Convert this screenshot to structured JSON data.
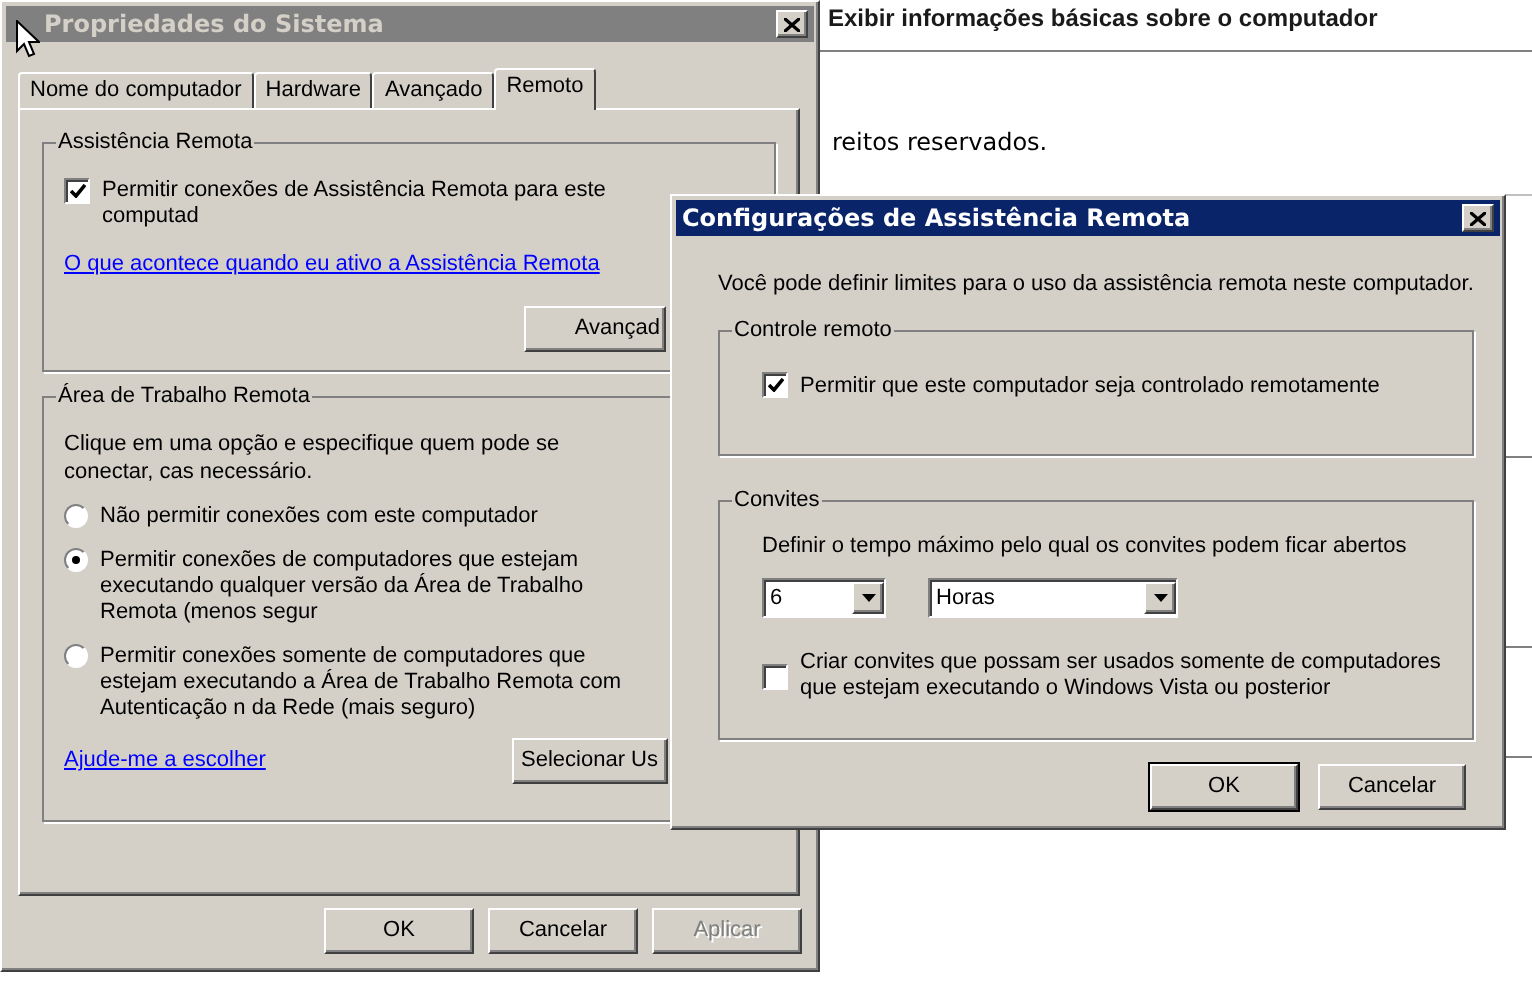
{
  "background": {
    "heading": "Exibir informações básicas sobre o computador",
    "text": "reitos reservados."
  },
  "system_properties": {
    "title": "Propriedades do Sistema",
    "active": false,
    "tabs": [
      {
        "label": "Nome do computador",
        "selected": false
      },
      {
        "label": "Hardware",
        "selected": false
      },
      {
        "label": "Avançado",
        "selected": false
      },
      {
        "label": "Remoto",
        "selected": true
      }
    ],
    "remote_assistance": {
      "title": "Assistência Remota",
      "checkbox": {
        "label": "Permitir conexões de Assistência Remota para este computad",
        "checked": true
      },
      "link": "O que acontece quando eu ativo a Assistência Remota",
      "button": "Avançad"
    },
    "remote_desktop": {
      "title": "Área de Trabalho Remota",
      "description": "Clique em uma opção e especifique quem pode se conectar, cas necessário.",
      "options": [
        {
          "label": "Não permitir conexões com este computador",
          "selected": false
        },
        {
          "label": "Permitir conexões de computadores que estejam executando qualquer versão da Área de Trabalho Remota (menos segur",
          "selected": true
        },
        {
          "label": "Permitir conexões somente de computadores que estejam executando a Área de Trabalho Remota com Autenticação n da Rede (mais seguro)",
          "selected": false
        }
      ],
      "link": "Ajude-me a escolher",
      "button": "Selecionar Us"
    },
    "buttons": [
      {
        "label": "OK",
        "disabled": false
      },
      {
        "label": "Cancelar",
        "disabled": false
      },
      {
        "label": "Aplicar",
        "disabled": true
      }
    ]
  },
  "remote_assistance_settings": {
    "title": "Configurações de Assistência Remota",
    "active": true,
    "intro": "Você pode definir limites para o uso da assistência remota neste computador.",
    "remote_control": {
      "title": "Controle remoto",
      "checkbox": {
        "label": "Permitir que este computador seja controlado remotamente",
        "checked": true
      }
    },
    "invitations": {
      "title": "Convites",
      "description": "Definir o tempo máximo pelo qual os convites podem ficar abertos",
      "amount": "6",
      "unit": "Horas",
      "checkbox": {
        "label": "Criar convites que possam ser usados somente de computadores que estejam executando o Windows Vista ou posterior",
        "checked": false
      }
    },
    "buttons": [
      {
        "label": "OK",
        "default": true
      },
      {
        "label": "Cancelar",
        "default": false
      }
    ]
  }
}
